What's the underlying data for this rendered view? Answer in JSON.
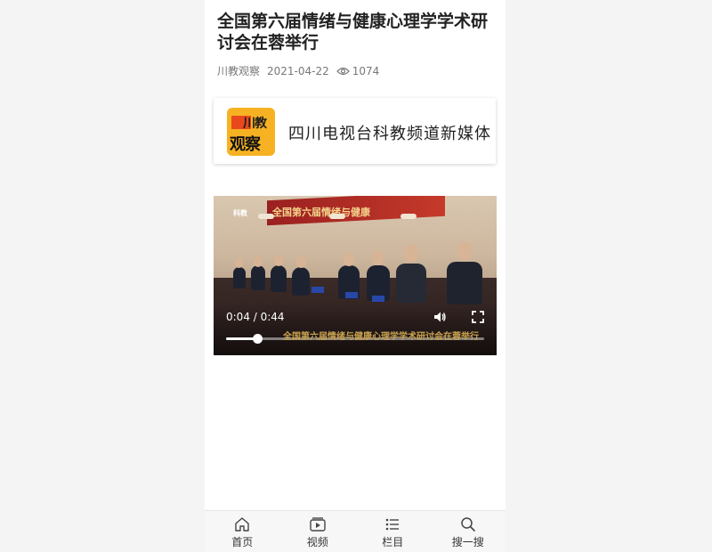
{
  "article": {
    "title": "全国第六届情绪与健康心理学学术研讨会在蓉举行",
    "source": "川教观察",
    "date": "2021-04-22",
    "views": "1074"
  },
  "promo_card": {
    "logo_text_top": "川教",
    "logo_text_bottom": "观察",
    "text": "四川电视台科教频道新媒体"
  },
  "video": {
    "time_display": "0:04 / 0:44",
    "progress": 0.12,
    "overlay_banner": "全国第六届情绪与健康",
    "overlay_subtitle": "全国第六届情绪与健康心理学学术研讨会在蓉举行",
    "channel_mark": "科教"
  },
  "tabbar": {
    "items": [
      {
        "label": "首页",
        "icon": "home-icon"
      },
      {
        "label": "视频",
        "icon": "video-icon"
      },
      {
        "label": "栏目",
        "icon": "list-icon"
      },
      {
        "label": "搜一搜",
        "icon": "search-icon"
      }
    ]
  }
}
